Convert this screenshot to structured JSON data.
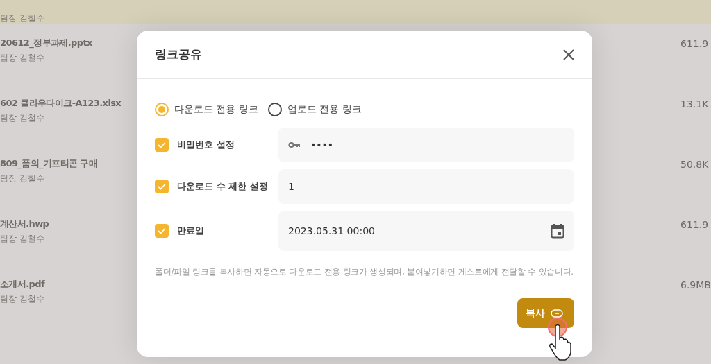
{
  "files": [
    {
      "owner": "팀장 김철수",
      "selected": true
    },
    {
      "name": "20612_정부과제.pptx",
      "owner": "팀장 김철수",
      "size": "611.9",
      "selected": false
    },
    {
      "name": "602 클라우다이크-A123.xlsx",
      "owner": "팀장 김철수",
      "size": "13.1K",
      "selected": false
    },
    {
      "name": "809_품의_기프티콘 구매",
      "owner": "팀장 김철수",
      "size": "50.8K",
      "selected": false
    },
    {
      "name": "계산서.hwp",
      "owner": "팀장 김철수",
      "size": "611.9",
      "selected": false
    },
    {
      "name": "소개서.pdf",
      "owner": "팀장 김철수",
      "size": "6.9MB",
      "selected": false
    }
  ],
  "dialog": {
    "title": "링크공유",
    "link_types": [
      {
        "label": "다운로드 전용 링크",
        "selected": true
      },
      {
        "label": "업로드 전용 링크",
        "selected": false
      }
    ],
    "options": [
      {
        "label": "비밀번호 설정",
        "checked": true,
        "kind": "password",
        "value": "••••"
      },
      {
        "label": "다운로드 수 제한 설정",
        "checked": true,
        "kind": "text",
        "value": "1"
      },
      {
        "label": "만료일",
        "checked": true,
        "kind": "date",
        "value": "2023.05.31 00:00"
      }
    ],
    "help": "폴더/파일 링크를 복사하면 자동으로 다운로드 전용 링크가 생성되며, 붙여넣기하면 게스트에게 전달할 수 있습니다.",
    "copy_button": "복사"
  }
}
